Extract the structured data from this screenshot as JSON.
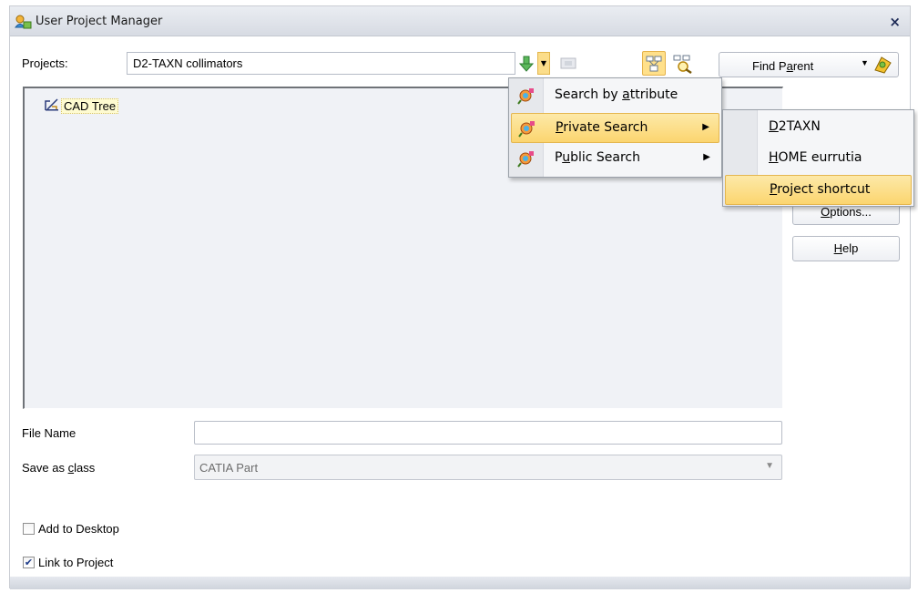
{
  "window": {
    "title": "User Project Manager",
    "close_glyph": "×"
  },
  "projects": {
    "label": "Projects:",
    "value": "D2-TAXN collimators"
  },
  "find_parent": {
    "label_pre": "Find P",
    "label_ul": "a",
    "label_post": "rent"
  },
  "tree": {
    "root_label": "CAD Tree"
  },
  "side_buttons": {
    "options_pre": "",
    "options_ul": "O",
    "options_post": "ptions...",
    "help_pre": "",
    "help_ul": "H",
    "help_post": "elp"
  },
  "file_name": {
    "label": "File Name",
    "value": ""
  },
  "save_as": {
    "label_pre": "Save as ",
    "label_ul": "c",
    "label_post": "lass",
    "value": "CATIA Part"
  },
  "checkboxes": {
    "add_to_desktop": {
      "label": "Add to Desktop",
      "checked": false
    },
    "link_to_project": {
      "label": "Link to Project",
      "checked": true,
      "glyph": "✔"
    }
  },
  "search_menu": {
    "items": [
      {
        "pre": "Search by ",
        "ul": "a",
        "post": "ttribute"
      },
      {
        "pre": "",
        "ul": "P",
        "post": "rivate Search"
      },
      {
        "pre": "P",
        "ul": "u",
        "post": "blic Search"
      }
    ]
  },
  "submenu": {
    "items": [
      {
        "pre": "",
        "ul": "D",
        "post": "2TAXN"
      },
      {
        "pre": "",
        "ul": "H",
        "post": "OME eurrutia"
      },
      {
        "pre": "",
        "ul": "P",
        "post": "roject shortcut"
      }
    ]
  },
  "colors": {
    "highlight": "#fbd56f",
    "tree_background": "#f0f2f6"
  },
  "icons": {
    "title": "user-project-manager-icon",
    "down_arrow": "green-down-arrow-icon",
    "tree": "tree-view-icon",
    "tree_search": "tree-search-icon",
    "find_parent": "find-parent-icon",
    "cad_tree": "cad-tree-icon",
    "search": "search-attribute-icon"
  }
}
